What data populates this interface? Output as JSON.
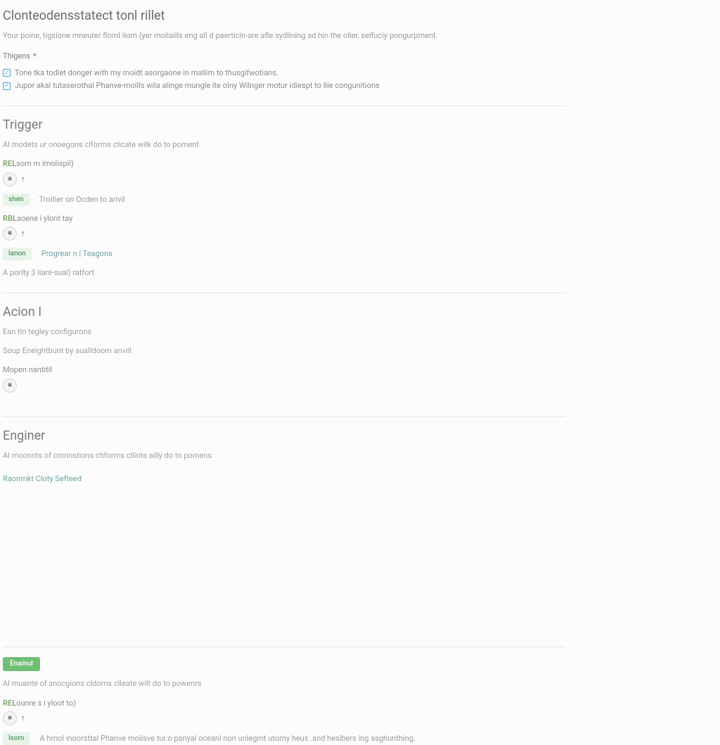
{
  "header": {
    "title": "Clonteodensstatect tonl rillet",
    "subtitle": "Your poine, tigsione mneuter floml ilom (yer mollaiils eng all d paerticin-are afle sydlining ad hin the oller, selfuciy pongurpment.",
    "dropdown_label": "Thigens",
    "checkbox1": "Tone tka todlet donger with my moidt asorgaone in mallim to thusgifwotians.",
    "checkbox2": "Jupor akal tutaserothal Phanve-moills wila alinge mungle ite oIny Wilnger motur idiespt to llie congunitions"
  },
  "trigger": {
    "heading": "Trigger",
    "desc": "Al modets ur onoegons clforms clicate wilk do to poment",
    "field1_label": "som m imolispil)",
    "field1_prefix": "REL",
    "pill1": "shen",
    "pill1_text": "Troitier on Ocden to arivil",
    "field2_label": "aoene i ylont tay",
    "field2_prefix": "RBL",
    "pill2": "lanon",
    "pill2_text": "Progrear n | Teagons",
    "note": "A porlty 3 lianl-sual) ratfort"
  },
  "action": {
    "heading": "Acion I",
    "line1": "Ean tln tegley configurons",
    "line2": "Soup Eneightbunt by aualldoom anvill",
    "field_label": "Mopen nantitil",
    "stepper_value": "■"
  },
  "enginer": {
    "heading": "Enginer",
    "desc": "Al moonnts of cmnnstions chforms cllinte ailly do to pomens",
    "link": "Raonmkt Cloty Sefteed"
  },
  "footer": {
    "badge": "Enainul",
    "desc": "Al muante of snocgions cldorns clleate wilt do to powenrs",
    "field_label": "ounre s i yloot to)",
    "field_prefix": "REL",
    "pill": "lsorn",
    "pill_text": "A hmol inoorsttal Phanve moilsve tur.o panyal oceanl non unlegmt utorny heus .and hesibers ing asghunthing."
  }
}
